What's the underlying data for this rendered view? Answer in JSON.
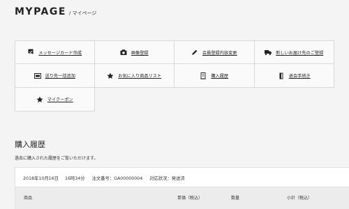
{
  "header": {
    "title": "MYPAGE",
    "subtitle": "/ マイページ"
  },
  "menu": [
    {
      "label": "メッセージカード作成",
      "icon": "message-card-icon"
    },
    {
      "label": "画像登録",
      "icon": "camera-icon"
    },
    {
      "label": "会員登録内容変更",
      "icon": "pencil-icon"
    },
    {
      "label": "新しいお届け先のご登録",
      "icon": "truck-icon"
    },
    {
      "label": "送り先一括追加",
      "icon": "address-batch-icon"
    },
    {
      "label": "お気に入り商品リスト",
      "icon": "star-icon"
    },
    {
      "label": "購入履歴",
      "icon": "receipt-icon"
    },
    {
      "label": "退会手続き",
      "icon": "door-icon"
    },
    {
      "label": "マイクーポン",
      "icon": "star-icon"
    }
  ],
  "history": {
    "title": "購入履歴",
    "description": "過去に購入された履歴をご覧いただけます。",
    "order": {
      "date": "2018年10月16日",
      "time": "16時34分",
      "order_no": "注文番号：GA00000004",
      "status": "対応状況：発送済"
    },
    "columns": {
      "product": "商品",
      "unit_price": "単価（税込）",
      "quantity": "数量",
      "subtotal": "小計（税込）"
    }
  }
}
